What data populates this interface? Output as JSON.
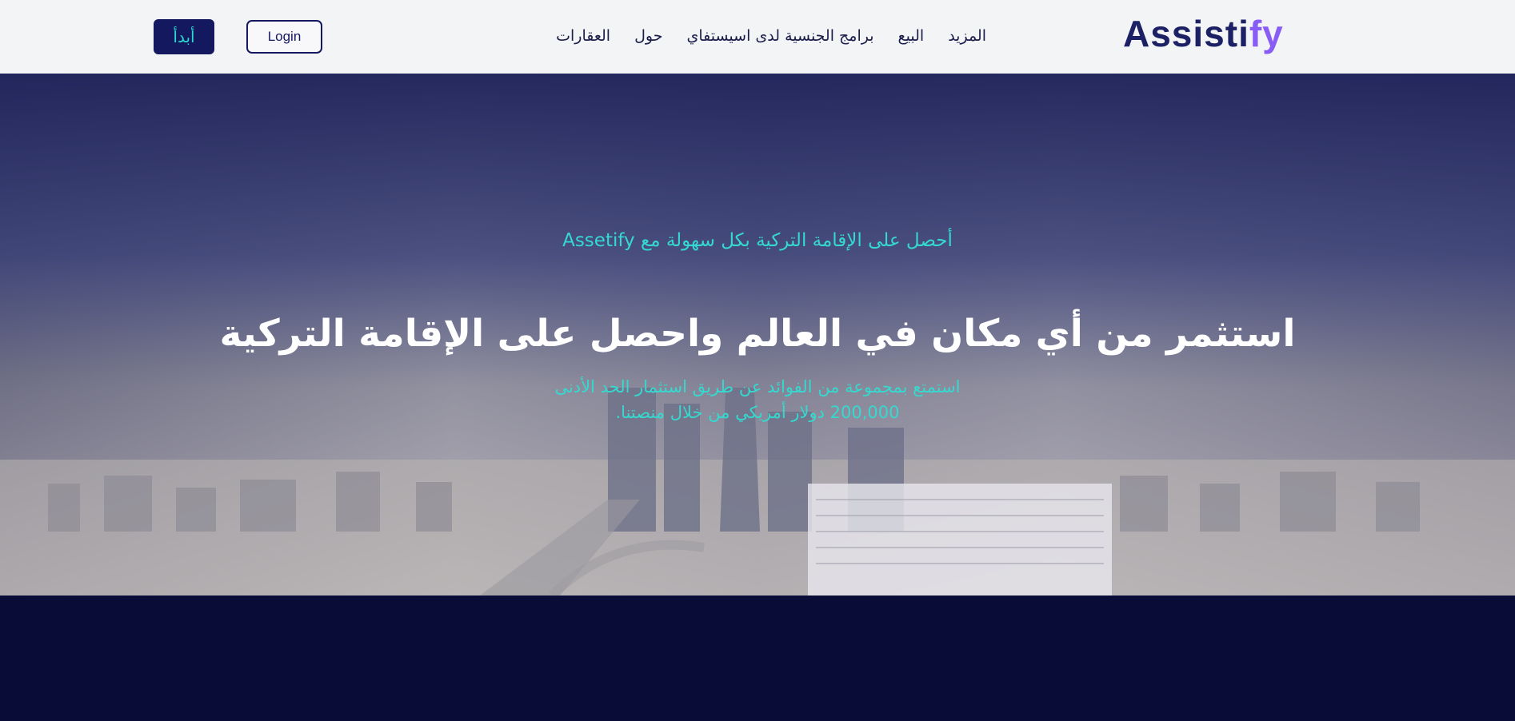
{
  "header": {
    "logo": {
      "main": "Assisti",
      "accent": "fy"
    },
    "nav": [
      "المزيد",
      "البيع",
      "برامج الجنسية لدى اسيستفاي",
      "حول",
      "العقارات"
    ],
    "login_label": "Login",
    "start_label": "أبدأ"
  },
  "hero": {
    "subtitle": "Assetify أحصل على الإقامة التركية بكل سهولة مع",
    "title": "استثمر من أي مكان في العالم واحصل على الإقامة التركية",
    "description_line1": "استمتع بمجموعة من الفوائد عن طريق استثمار الحد الأدنى",
    "description_line2": "200,000 دولار أمريكي من خلال منصتنا."
  },
  "colors": {
    "brand": "#14185f",
    "accent": "#34d9cf",
    "logo_accent": "#8a5cf6",
    "footer": "#0a0c38"
  }
}
